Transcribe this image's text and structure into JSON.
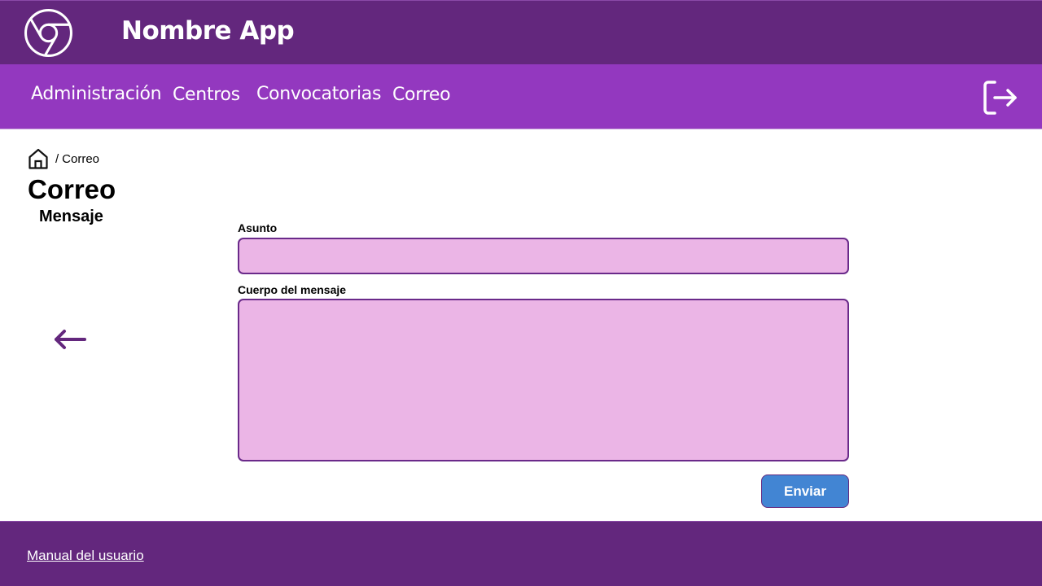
{
  "header": {
    "app_title": "Nombre App",
    "logo_icon": "chrome-like-logo-icon"
  },
  "nav": {
    "items": [
      {
        "label": "Administración"
      },
      {
        "label": "Centros"
      },
      {
        "label": "Convocatorias"
      },
      {
        "label": "Correo"
      }
    ],
    "logout_icon": "logout-icon"
  },
  "breadcrumb": {
    "home_icon": "home-icon",
    "separator": "/",
    "current": "Correo"
  },
  "page": {
    "title": "Correo",
    "subtitle": "Mensaje",
    "back_icon": "arrow-left-icon"
  },
  "form": {
    "subject_label": "Asunto",
    "subject_value": "",
    "body_label": "Cuerpo del mensaje",
    "body_value": "",
    "send_label": "Enviar"
  },
  "footer": {
    "manual_link": "Manual del usuario"
  },
  "colors": {
    "header_bg": "#63277d",
    "nav_bg": "#9338bf",
    "field_bg": "#ebb5e6",
    "field_border": "#6a2a8a",
    "button_bg": "#4285d3"
  }
}
